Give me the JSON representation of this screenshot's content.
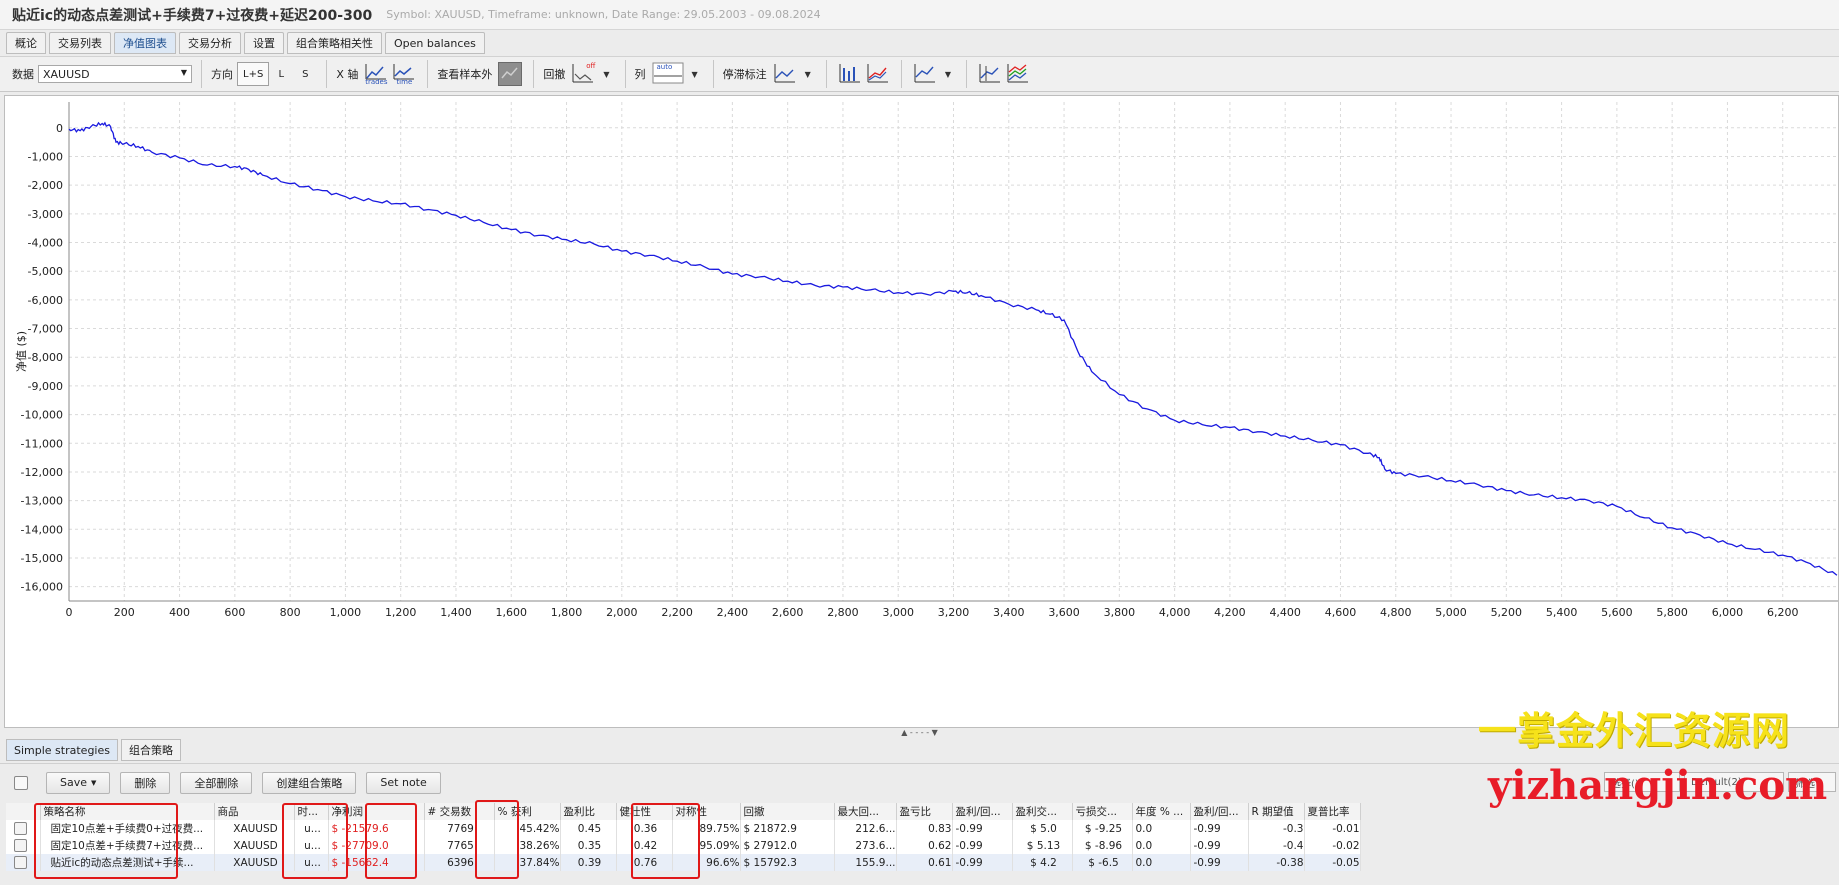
{
  "window": {
    "title": "贴近ic的动态点差测试+手续费7+过夜费+延迟200-300",
    "meta": "Symbol: XAUUSD, Timeframe: unknown, Date Range: 29.05.2003 - 09.08.2024"
  },
  "tabs": [
    {
      "label": "概论"
    },
    {
      "label": "交易列表"
    },
    {
      "label": "净值图表",
      "active": true
    },
    {
      "label": "交易分析"
    },
    {
      "label": "设置"
    },
    {
      "label": "组合策略相关性"
    },
    {
      "label": "Open balances"
    }
  ],
  "toolbar": {
    "data_label": "数据",
    "symbol_value": "XAUUSD",
    "direction_label": "方向",
    "dir_ls": "L+S",
    "dir_l": "L",
    "dir_s": "S",
    "xaxis_label": "X 轴",
    "trades_caption": "trades",
    "time_caption": "time",
    "oos_label": "查看样本外",
    "drawdown_label": "回撤",
    "off_caption": "off",
    "columns_label": "列",
    "auto_caption": "auto",
    "stagnation_label": "停滞标注"
  },
  "chart_data": {
    "type": "line",
    "xlabel": "",
    "ylabel": "净值 ($)",
    "xlim": [
      0,
      6400
    ],
    "ylim": [
      -16500,
      900
    ],
    "x_ticks": [
      0,
      200,
      400,
      600,
      800,
      1000,
      1200,
      1400,
      1600,
      1800,
      2000,
      2200,
      2400,
      2600,
      2800,
      3000,
      3200,
      3400,
      3600,
      3800,
      4000,
      4200,
      4400,
      4600,
      4800,
      5000,
      5200,
      5400,
      5600,
      5800,
      6000,
      6200
    ],
    "x_tick_labels": [
      "0",
      "200",
      "400",
      "600",
      "800",
      "1,000",
      "1,200",
      "1,400",
      "1,600",
      "1,800",
      "2,000",
      "2,200",
      "2,400",
      "2,600",
      "2,800",
      "3,000",
      "3,200",
      "3,400",
      "3,600",
      "3,800",
      "4,000",
      "4,200",
      "4,400",
      "4,600",
      "4,800",
      "5,000",
      "5,200",
      "5,400",
      "5,600",
      "5,800",
      "6,000",
      "6,200"
    ],
    "y_ticks": [
      0,
      -1000,
      -2000,
      -3000,
      -4000,
      -5000,
      -6000,
      -7000,
      -8000,
      -9000,
      -10000,
      -11000,
      -12000,
      -13000,
      -14000,
      -15000,
      -16000
    ],
    "y_tick_labels": [
      "0",
      "-1,000",
      "-2,000",
      "-3,000",
      "-4,000",
      "-5,000",
      "-6,000",
      "-7,000",
      "-8,000",
      "-9,000",
      "-10,000",
      "-11,000",
      "-12,000",
      "-13,000",
      "-14,000",
      "-15,000",
      "-16,000"
    ],
    "grid": true,
    "series": [
      {
        "color": "#1a1adf",
        "x": [
          0,
          40,
          80,
          120,
          150,
          170,
          200,
          250,
          300,
          400,
          500,
          600,
          650,
          700,
          800,
          900,
          1000,
          1100,
          1200,
          1300,
          1400,
          1500,
          1600,
          1700,
          1800,
          1900,
          2000,
          2100,
          2200,
          2300,
          2400,
          2500,
          2600,
          2700,
          2800,
          2900,
          3000,
          3100,
          3200,
          3250,
          3300,
          3400,
          3500,
          3550,
          3600,
          3650,
          3700,
          3800,
          3900,
          4000,
          4100,
          4200,
          4300,
          4400,
          4500,
          4600,
          4700,
          4740,
          4760,
          4800,
          4900,
          5000,
          5100,
          5200,
          5300,
          5400,
          5500,
          5600,
          5700,
          5800,
          5900,
          6000,
          6100,
          6200,
          6300,
          6396
        ],
        "y": [
          -50,
          -100,
          50,
          150,
          50,
          -500,
          -550,
          -650,
          -850,
          -1050,
          -1300,
          -1350,
          -1450,
          -1650,
          -1950,
          -2150,
          -2400,
          -2550,
          -2650,
          -2850,
          -3050,
          -3300,
          -3550,
          -3750,
          -3900,
          -4050,
          -4300,
          -4450,
          -4650,
          -4850,
          -5100,
          -5200,
          -5350,
          -5500,
          -5550,
          -5650,
          -5750,
          -5800,
          -5700,
          -5750,
          -5850,
          -6150,
          -6350,
          -6500,
          -6700,
          -7800,
          -8500,
          -9300,
          -9800,
          -10200,
          -10350,
          -10450,
          -10600,
          -10750,
          -10900,
          -11050,
          -11350,
          -11500,
          -11900,
          -12050,
          -12150,
          -12300,
          -12450,
          -12650,
          -12800,
          -12900,
          -13000,
          -13200,
          -13600,
          -13950,
          -14200,
          -14500,
          -14700,
          -14900,
          -15200,
          -15600
        ]
      }
    ]
  },
  "bottom_tabs": [
    {
      "label": "Simple strategies",
      "active": true
    },
    {
      "label": "组合策略"
    }
  ],
  "bottom_toolbar": {
    "save": "Save",
    "delete": "删除",
    "delete_all": "全部删除",
    "create_portfolio": "创建组合策略",
    "set_note": "Set note",
    "right1": "选择()",
    "right2": "Default(2)",
    "right3": "筛选"
  },
  "table": {
    "columns": [
      "策略名称",
      "商品",
      "时...",
      "净利润",
      "# 交易数",
      "% 获利",
      "盈利比",
      "健壮性",
      "对称性",
      "回撤",
      "最大回...",
      "盈亏比",
      "盈利/回...",
      "盈利交...",
      "亏损交...",
      "年度 % ...",
      "盈利/回...",
      "R 期望值",
      "夏普比率"
    ],
    "rows": [
      [
        "固定10点差+手续费0+过夜费...",
        "XAUUSD",
        "u...",
        "$ -21579.6",
        "7769",
        "45.42%",
        "0.45",
        "0.36",
        "89.75%",
        "$ 21872.9",
        "212.6...",
        "0.83",
        "-0.99",
        "$ 5.0",
        "$ -9.25",
        "0.0",
        "-0.99",
        "-0.3",
        "-0.01"
      ],
      [
        "固定10点差+手续费7+过夜费...",
        "XAUUSD",
        "u...",
        "$ -27709.0",
        "7765",
        "38.26%",
        "0.35",
        "0.42",
        "95.09%",
        "$ 27912.0",
        "273.6...",
        "0.62",
        "-0.99",
        "$ 5.13",
        "$ -8.96",
        "0.0",
        "-0.99",
        "-0.4",
        "-0.02"
      ],
      [
        "贴近ic的动态点差测试+手续...",
        "XAUUSD",
        "u...",
        "$ -15662.4",
        "6396",
        "37.84%",
        "0.39",
        "0.76",
        "96.6%",
        "$ 15792.3",
        "155.9...",
        "0.61",
        "-0.99",
        "$ 4.2",
        "$ -6.5",
        "0.0",
        "-0.99",
        "-0.38",
        "-0.05"
      ]
    ]
  },
  "watermark": {
    "line1": "一掌金外汇资源网",
    "line2": "yizhangjin.com"
  }
}
